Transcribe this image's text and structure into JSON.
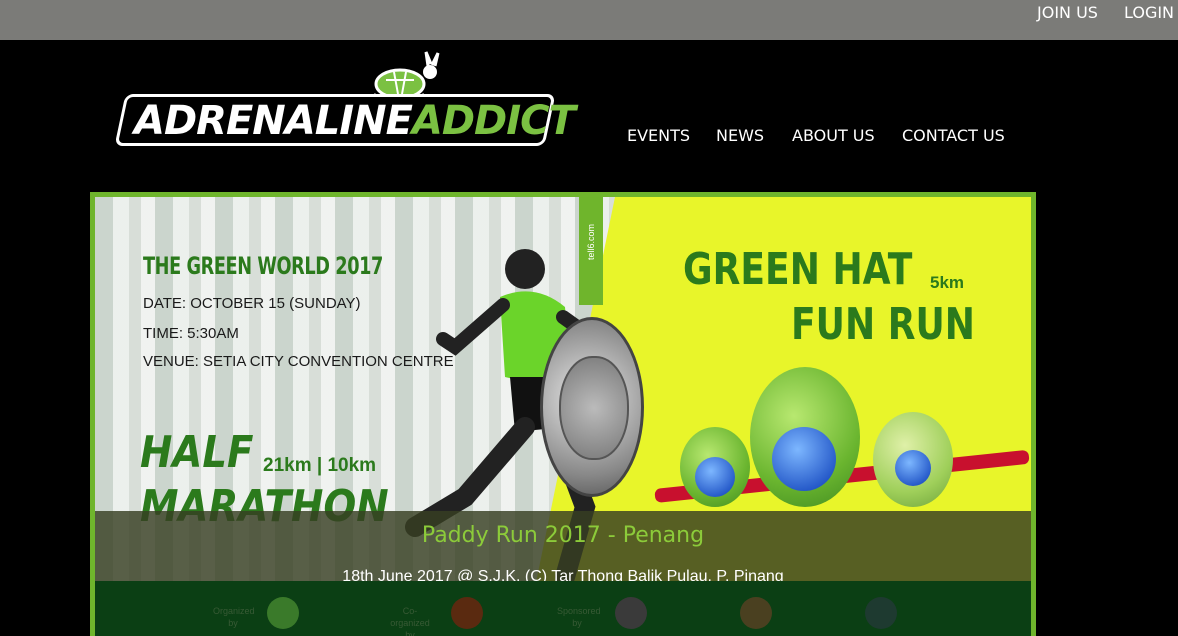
{
  "topbar": {
    "join": "JOIN US",
    "login": "LOGIN"
  },
  "logo": {
    "part1": "ADRENALINE",
    "part2": "ADDICT"
  },
  "nav": [
    "EVENTS",
    "NEWS",
    "ABOUT US",
    "CONTACT US"
  ],
  "banner": {
    "title": "THE GREEN WORLD 2017",
    "date": "DATE: OCTOBER 15 (SUNDAY)",
    "time": "TIME: 5:30AM",
    "venue": "VENUE: SETIA CITY CONVENTION CENTRE",
    "half1": "HALF",
    "half2": "MARATHON",
    "distances": "21km | 10km",
    "ribbon_text": "tell6.com",
    "fun1": "GREEN HAT",
    "fun2": "FUN RUN",
    "fun_distance": "5km",
    "footer": {
      "organized": "Organized by",
      "coorganized": "Co-organized by",
      "sponsored": "Sponsored by"
    }
  },
  "caption": {
    "title": "Paddy Run 2017 - Penang",
    "subtitle": "18th June 2017 @ S.J.K. (C) Tar Thong Balik Pulau, P. Pinang"
  },
  "colors": {
    "brand_green": "#7bc142",
    "dark_green": "#2b7a1c",
    "yellow": "#e8f52a",
    "topbar": "#7b7b78"
  }
}
